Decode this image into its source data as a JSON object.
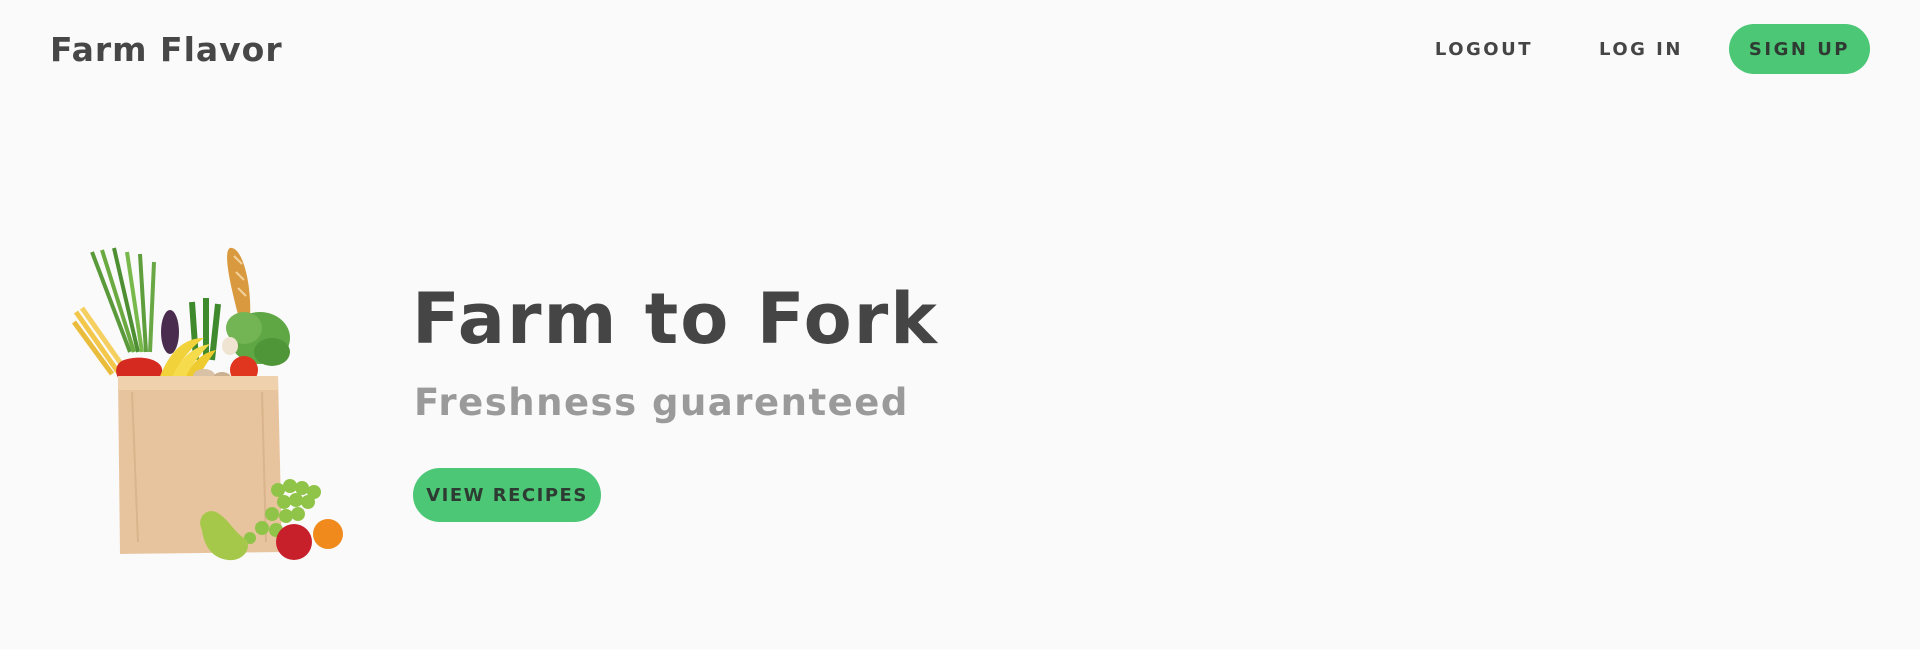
{
  "header": {
    "brand": "Farm Flavor",
    "nav": {
      "logout_label": "LOGOUT",
      "login_label": "LOG IN",
      "signup_label": "SIGN UP"
    }
  },
  "hero": {
    "title": "Farm to Fork",
    "subtitle": "Freshness guarenteed",
    "cta_label": "VIEW RECIPES",
    "image_icon": "grocery-bag-image"
  },
  "colors": {
    "background": "#fafafa",
    "accent": "#4bc775",
    "text": "#454545",
    "muted": "#9a9a9a"
  }
}
